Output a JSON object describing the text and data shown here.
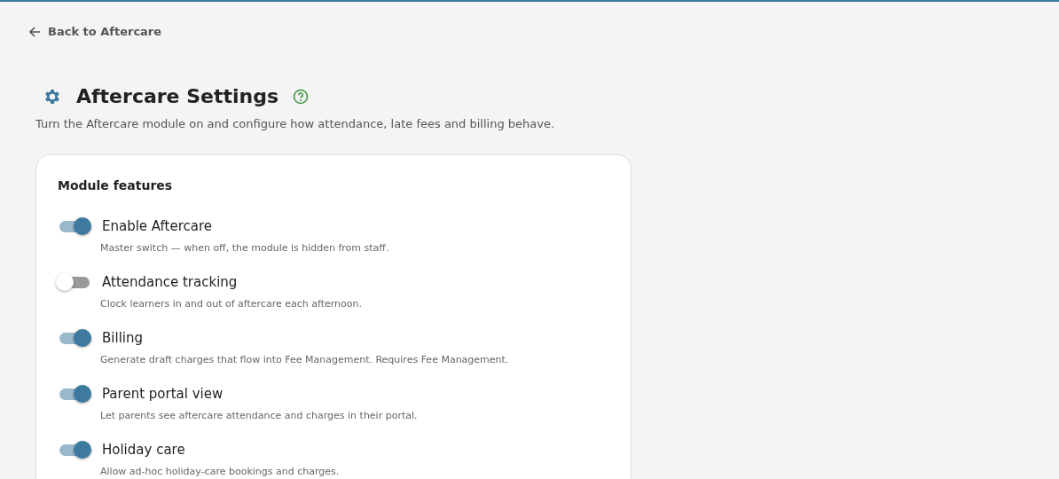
{
  "back_link": "Back to Aftercare",
  "title": "Aftercare Settings",
  "description": "Turn the Aftercare module on and configure how attendance, late fees and billing behave.",
  "card": {
    "heading": "Module features",
    "features": [
      {
        "label": "Enable Aftercare",
        "hint": "Master switch — when off, the module is hidden from staff.",
        "on": true
      },
      {
        "label": "Attendance tracking",
        "hint": "Clock learners in and out of aftercare each afternoon.",
        "on": false
      },
      {
        "label": "Billing",
        "hint": "Generate draft charges that flow into Fee Management. Requires Fee Management.",
        "on": true
      },
      {
        "label": "Parent portal view",
        "hint": "Let parents see aftercare attendance and charges in their portal.",
        "on": true
      },
      {
        "label": "Holiday care",
        "hint": "Allow ad-hoc holiday-care bookings and charges.",
        "on": true
      }
    ]
  }
}
